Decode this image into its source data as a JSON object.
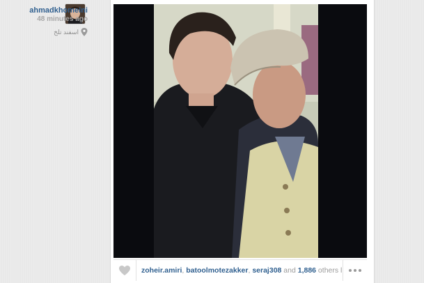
{
  "user": {
    "username": "ahmadkhomeini",
    "time_ago": "48 minutes ago",
    "location": "اسفند تلخ",
    "avatar_icon": "profile-photo"
  },
  "post": {
    "photo_icon": "photo",
    "likes": {
      "names": [
        "zoheir.amiri",
        "batoolmotezakker",
        "seraj308"
      ],
      "separator": ", ",
      "and_text": " and ",
      "count": "1,886",
      "tail": " others lik..."
    },
    "like_icon": "heart-icon",
    "more_icon": "more-icon"
  },
  "colors": {
    "link": "#2f5f8f",
    "muted": "#9a9a9a"
  }
}
